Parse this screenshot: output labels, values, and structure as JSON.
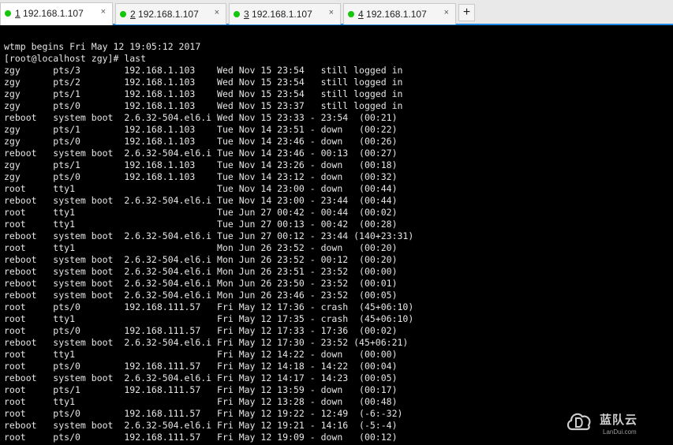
{
  "tabs": [
    {
      "num": "1",
      "title": " 192.168.1.107",
      "close": "×",
      "active": true
    },
    {
      "num": "2",
      "title": " 192.168.1.107",
      "close": "×",
      "active": false
    },
    {
      "num": "3",
      "title": " 192.168.1.107",
      "close": "×",
      "active": false
    },
    {
      "num": "4",
      "title": " 192.168.1.107",
      "close": "×",
      "active": false
    }
  ],
  "add_tab_label": "+",
  "colors": {
    "tab_status_dot": "#16c60c",
    "accent": "#1e88e5",
    "terminal_bg": "#000000",
    "terminal_text": "#e6e6e6"
  },
  "terminal": {
    "lines": [
      "wtmp begins Fri May 12 19:05:12 2017",
      "[root@localhost zgy]# last",
      "zgy      pts/3        192.168.1.103    Wed Nov 15 23:54   still logged in",
      "zgy      pts/2        192.168.1.103    Wed Nov 15 23:54   still logged in",
      "zgy      pts/1        192.168.1.103    Wed Nov 15 23:54   still logged in",
      "zgy      pts/0        192.168.1.103    Wed Nov 15 23:37   still logged in",
      "reboot   system boot  2.6.32-504.el6.i Wed Nov 15 23:33 - 23:54  (00:21)",
      "zgy      pts/1        192.168.1.103    Tue Nov 14 23:51 - down   (00:22)",
      "zgy      pts/0        192.168.1.103    Tue Nov 14 23:46 - down   (00:26)",
      "reboot   system boot  2.6.32-504.el6.i Tue Nov 14 23:46 - 00:13  (00:27)",
      "zgy      pts/1        192.168.1.103    Tue Nov 14 23:26 - down   (00:18)",
      "zgy      pts/0        192.168.1.103    Tue Nov 14 23:12 - down   (00:32)",
      "root     tty1                          Tue Nov 14 23:00 - down   (00:44)",
      "reboot   system boot  2.6.32-504.el6.i Tue Nov 14 23:00 - 23:44  (00:44)",
      "root     tty1                          Tue Jun 27 00:42 - 00:44  (00:02)",
      "root     tty1                          Tue Jun 27 00:13 - 00:42  (00:28)",
      "reboot   system boot  2.6.32-504.el6.i Tue Jun 27 00:12 - 23:44 (140+23:31)",
      "root     tty1                          Mon Jun 26 23:52 - down   (00:20)",
      "reboot   system boot  2.6.32-504.el6.i Mon Jun 26 23:52 - 00:12  (00:20)",
      "reboot   system boot  2.6.32-504.el6.i Mon Jun 26 23:51 - 23:52  (00:00)",
      "reboot   system boot  2.6.32-504.el6.i Mon Jun 26 23:50 - 23:52  (00:01)",
      "reboot   system boot  2.6.32-504.el6.i Mon Jun 26 23:46 - 23:52  (00:05)",
      "root     pts/0        192.168.111.57   Fri May 12 17:36 - crash  (45+06:10)",
      "root     tty1                          Fri May 12 17:35 - crash  (45+06:10)",
      "root     pts/0        192.168.111.57   Fri May 12 17:33 - 17:36  (00:02)",
      "reboot   system boot  2.6.32-504.el6.i Fri May 12 17:30 - 23:52 (45+06:21)",
      "root     tty1                          Fri May 12 14:22 - down   (00:00)",
      "root     pts/0        192.168.111.57   Fri May 12 14:18 - 14:22  (00:04)",
      "reboot   system boot  2.6.32-504.el6.i Fri May 12 14:17 - 14:23  (00:05)",
      "root     pts/1        192.168.111.57   Fri May 12 13:59 - down   (00:17)",
      "root     tty1                          Fri May 12 13:28 - down   (00:48)",
      "root     pts/0        192.168.111.57   Fri May 12 19:22 - 12:49  (-6:-32)",
      "reboot   system boot  2.6.32-504.el6.i Fri May 12 19:21 - 14:16  (-5:-4)",
      "root     pts/0        192.168.111.57   Fri May 12 19:09 - down   (00:12)"
    ]
  },
  "watermark": {
    "name": "蓝队云",
    "url": "LanDui.com",
    "icon": "cloud-d-logo-icon"
  }
}
